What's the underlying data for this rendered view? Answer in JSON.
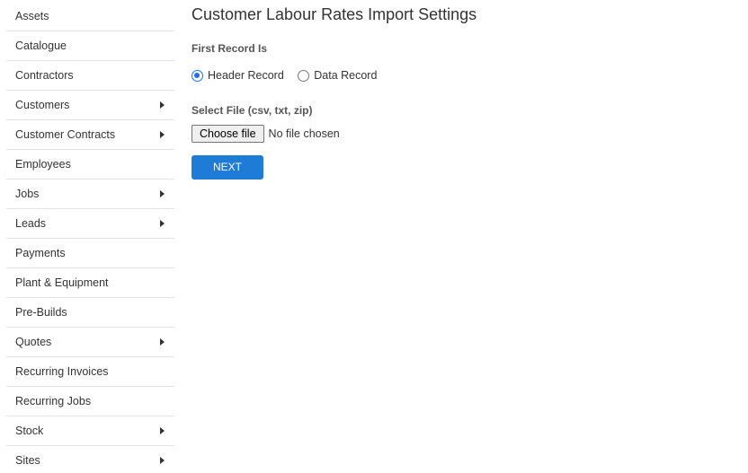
{
  "sidebar": {
    "items": [
      {
        "label": "Assets",
        "has_submenu": false
      },
      {
        "label": "Catalogue",
        "has_submenu": false
      },
      {
        "label": "Contractors",
        "has_submenu": false
      },
      {
        "label": "Customers",
        "has_submenu": true
      },
      {
        "label": "Customer Contracts",
        "has_submenu": true
      },
      {
        "label": "Employees",
        "has_submenu": false
      },
      {
        "label": "Jobs",
        "has_submenu": true
      },
      {
        "label": "Leads",
        "has_submenu": true
      },
      {
        "label": "Payments",
        "has_submenu": false
      },
      {
        "label": "Plant & Equipment",
        "has_submenu": false
      },
      {
        "label": "Pre-Builds",
        "has_submenu": false
      },
      {
        "label": "Quotes",
        "has_submenu": true
      },
      {
        "label": "Recurring Invoices",
        "has_submenu": false
      },
      {
        "label": "Recurring Jobs",
        "has_submenu": false
      },
      {
        "label": "Stock",
        "has_submenu": true
      },
      {
        "label": "Sites",
        "has_submenu": true
      }
    ]
  },
  "main": {
    "title": "Customer Labour Rates Import Settings",
    "first_record": {
      "label": "First Record Is",
      "options": [
        {
          "label": "Header Record",
          "checked": true
        },
        {
          "label": "Data Record",
          "checked": false
        }
      ]
    },
    "file": {
      "label": "Select File (csv, txt, zip)",
      "button_label": "Choose file",
      "status": "No file chosen"
    },
    "next_label": "NEXT"
  },
  "colors": {
    "accent": "#1f7cd6",
    "radio_checked": "#1a73e8"
  },
  "icons": {
    "submenu": "chevron-right-icon"
  }
}
